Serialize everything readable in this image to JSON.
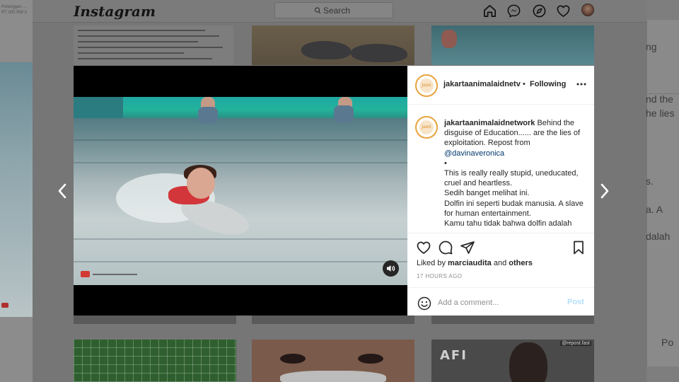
{
  "app": {
    "logo": "Instagram",
    "search_placeholder": "Search",
    "nav_icons": [
      "home-icon",
      "messenger-icon",
      "explore-icon",
      "heart-icon"
    ]
  },
  "background": {
    "doc_text": "Channel \"Anang Batas\" dengan ini kami laporkan sebagai berikut",
    "right_fragments": [
      "ng",
      "nd the",
      "he lies",
      "s.",
      "a. A",
      "dalah",
      "Po"
    ],
    "repost_tag": "@repost.fast",
    "thumb_text": "AFI"
  },
  "post": {
    "header": {
      "username": "jakartaanimalaidnetv",
      "separator": "•",
      "follow_status": "Following",
      "avatar_label": "jaan"
    },
    "caption": {
      "username": "jakartaanimalaidnetwork",
      "text_1": " Behind the disguise of Education...... are the lies of exploitation. Repost from ",
      "mention": "@davinaveronica",
      "bullet": "•",
      "text_2": "This is really really stupid, uneducated, cruel and heartless.",
      "text_3": "Sedih banget melihat ini.",
      "text_4": "Dolfin ini seperti budak manusia. A slave for human entertainment.",
      "text_5": "Kamu tahu tidak bahwa dolfin adalah"
    },
    "likes": {
      "prefix": "Liked by ",
      "user": "marciaudita",
      "middle": " and ",
      "others": "others"
    },
    "time_ago": "17 HOURS AGO",
    "comment_placeholder": "Add a comment...",
    "post_label": "Post",
    "video": {
      "muted": true
    }
  },
  "colors": {
    "accent_link": "#00376b",
    "post_button": "#b2dffc",
    "avatar_ring": "#e8a33d"
  }
}
